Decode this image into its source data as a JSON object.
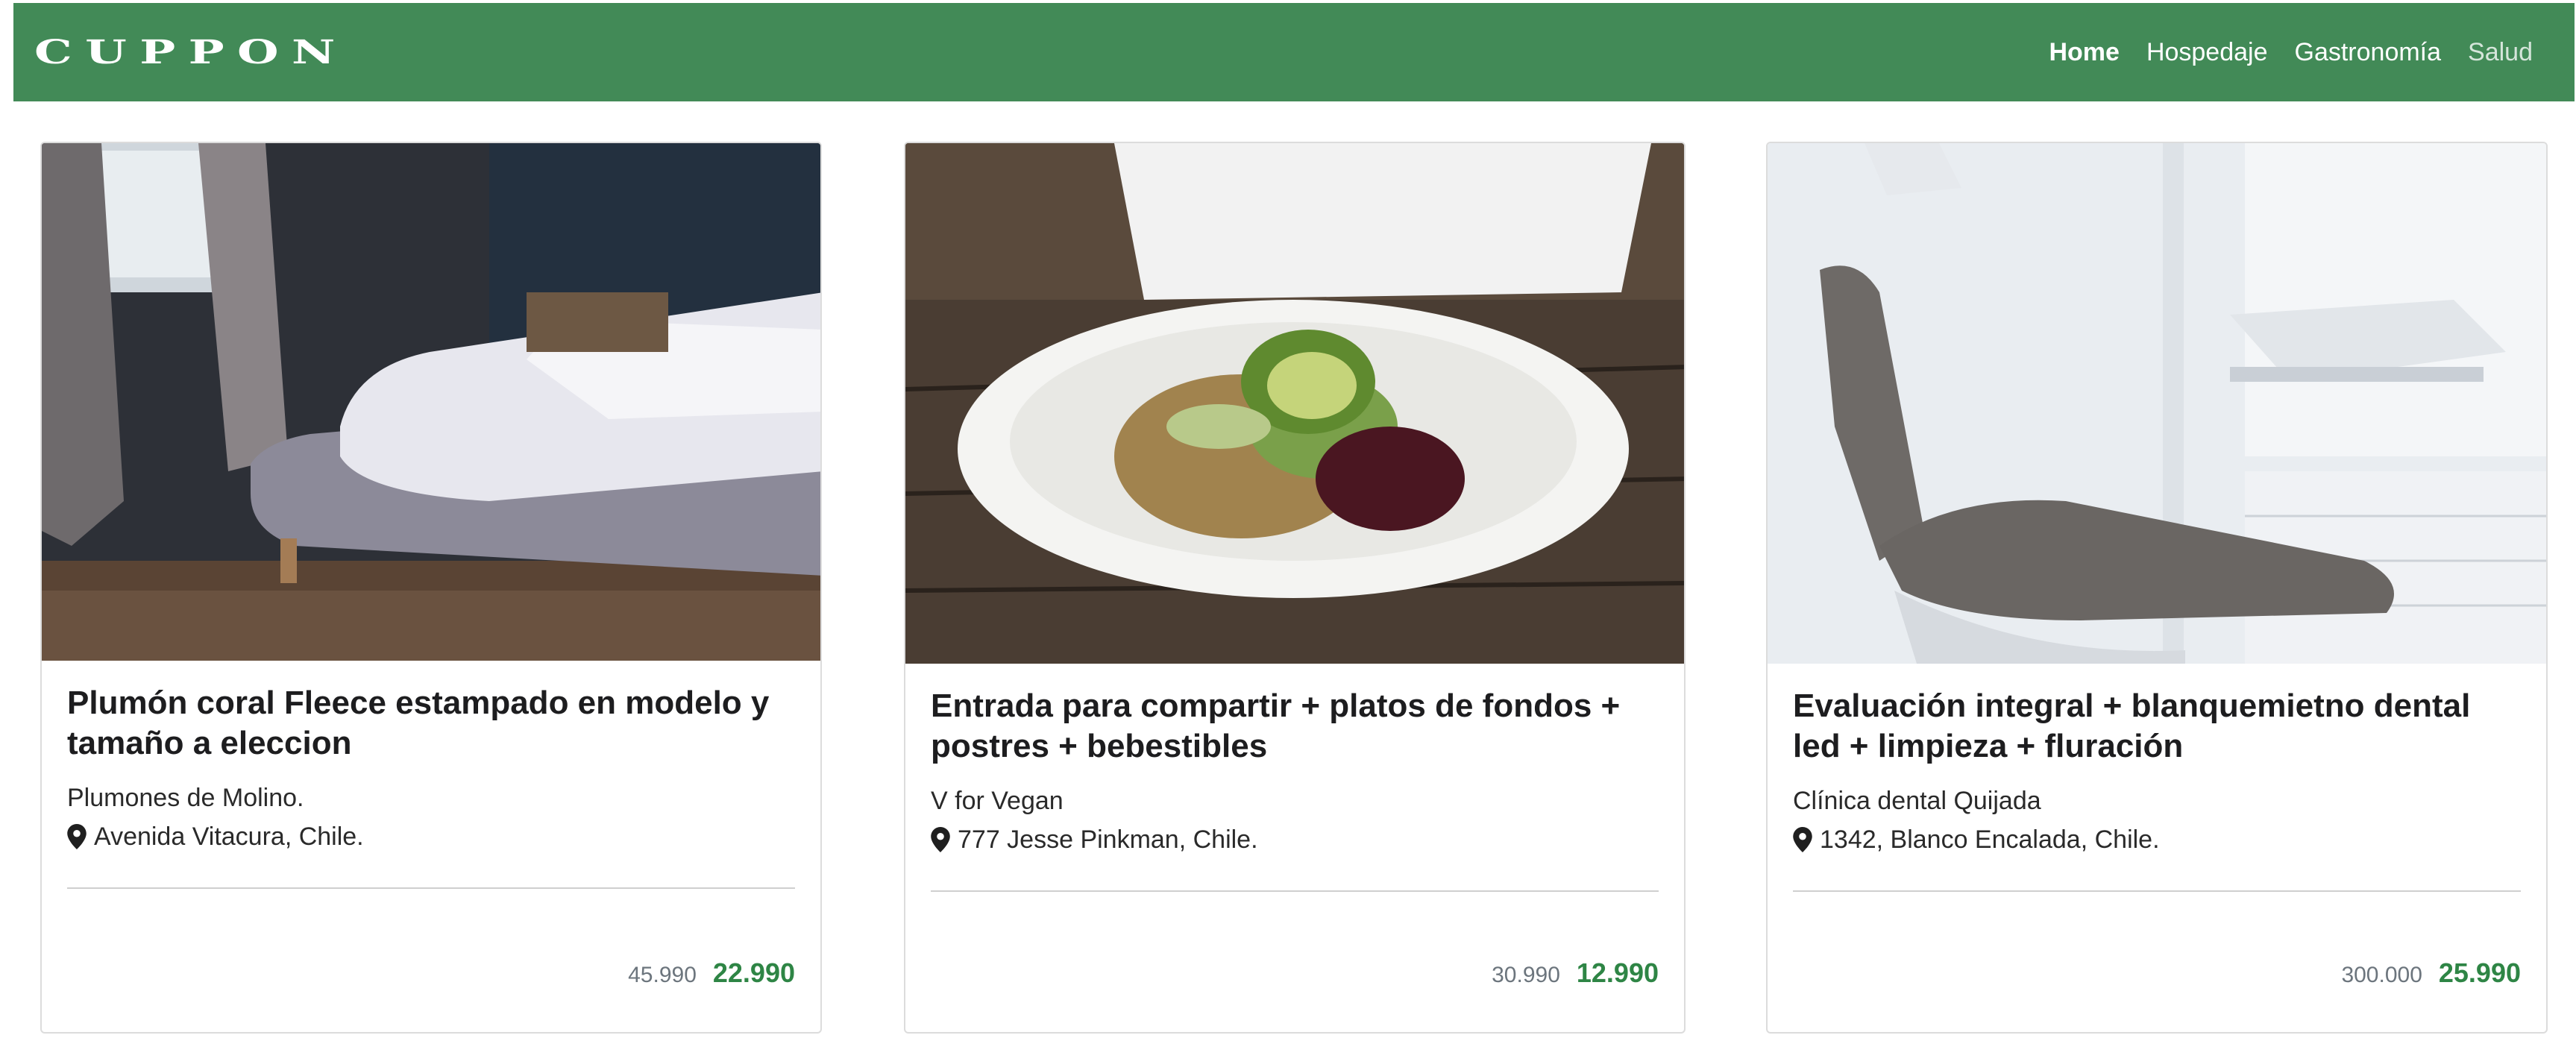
{
  "brand": "CUPPON",
  "nav": [
    {
      "label": "Home"
    },
    {
      "label": "Hospedaje"
    },
    {
      "label": "Gastronomía"
    },
    {
      "label": "Salud"
    }
  ],
  "colors": {
    "navbar": "#428a57",
    "price_new": "#2e8545",
    "price_old": "#6c757d"
  },
  "cards": [
    {
      "image_subject": "bedroom with white duvet on grey bed",
      "title": "Plumón coral Fleece estampado en modelo y tamaño a eleccion",
      "merchant": "Plumones de Molino.",
      "location": "Avenida Vitacura, Chile.",
      "price_old": "45.990",
      "price_new": "22.990",
      "icon": "map-marker-icon"
    },
    {
      "image_subject": "plate with avocado salad on wooden table",
      "title": "Entrada para compartir + platos de fondos + postres + bebestibles",
      "merchant": "V for Vegan",
      "location": "777 Jesse Pinkman, Chile.",
      "price_old": "30.990",
      "price_new": "12.990",
      "icon": "map-marker-icon"
    },
    {
      "image_subject": "dental chair in a white clinic",
      "title": "Evaluación integral + blanquemietno dental led + limpieza + fluración",
      "merchant": "Clínica dental Quijada",
      "location": "1342, Blanco Encalada, Chile.",
      "price_old": "300.000",
      "price_new": "25.990",
      "icon": "map-marker-icon"
    }
  ]
}
